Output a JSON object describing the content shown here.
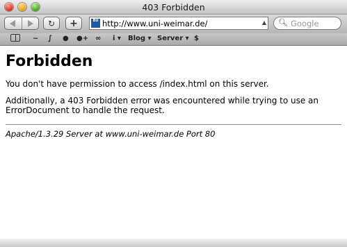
{
  "window": {
    "title": "403 Forbidden"
  },
  "toolbar": {
    "back_icon": "back-arrow-icon",
    "forward_icon": "forward-arrow-icon",
    "reload_glyph": "↻",
    "add_bookmark_glyph": "+",
    "favicon_text": "BU",
    "url": "http://www.uni-weimar.de/",
    "search_placeholder": "Google"
  },
  "bookmarks": {
    "items": [
      "~",
      "∫",
      "●",
      "●+",
      "∞",
      "i ▾",
      "Blog ▾",
      "Server ▾",
      "$"
    ]
  },
  "page": {
    "heading": "Forbidden",
    "message": "You don't have permission to access /index.html on this server.",
    "additional": "Additionally, a 403 Forbidden error was encountered while trying to use an ErrorDocument to handle the request.",
    "address": "Apache/1.3.29 Server at www.uni-weimar.de Port 80"
  }
}
